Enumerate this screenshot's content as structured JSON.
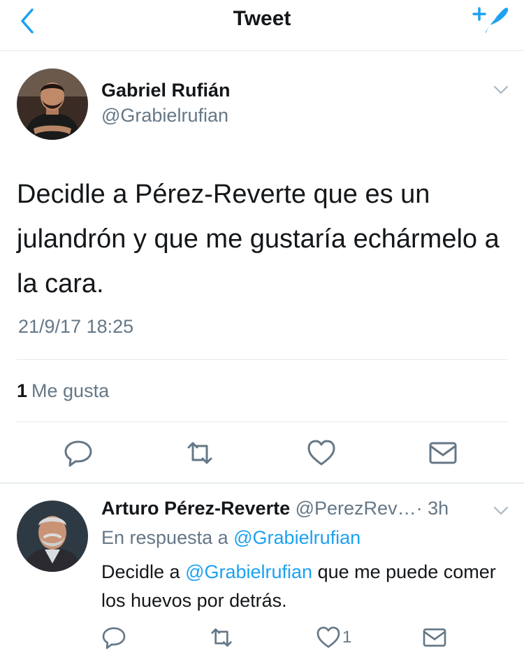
{
  "header": {
    "title": "Tweet",
    "back_icon": "chevron-left-icon",
    "compose_icon": "compose-tweet-icon",
    "accent_color": "#1da1f2"
  },
  "tweet": {
    "author_name": "Gabriel Rufián",
    "author_handle": "@Grabielrufian",
    "text": "Decidle a Pérez-Reverte que es un julandrón y que me gustaría echármelo a la cara.",
    "timestamp": "21/9/17 18:25",
    "likes_count": "1",
    "likes_label": "Me gusta",
    "actions": [
      "reply-icon",
      "retweet-icon",
      "like-icon",
      "direct-message-icon"
    ]
  },
  "reply": {
    "author_name": "Arturo Pérez-Reverte",
    "author_handle": "@PerezRev…",
    "separator": "·",
    "time": "3h",
    "in_reply_prefix": "En respuesta a",
    "in_reply_handle": "@Grabielrufian",
    "text_before": "Decidle a",
    "text_mention": "@Grabielrufian",
    "text_after": "que me puede comer los huevos por detrás.",
    "like_count": "1"
  }
}
